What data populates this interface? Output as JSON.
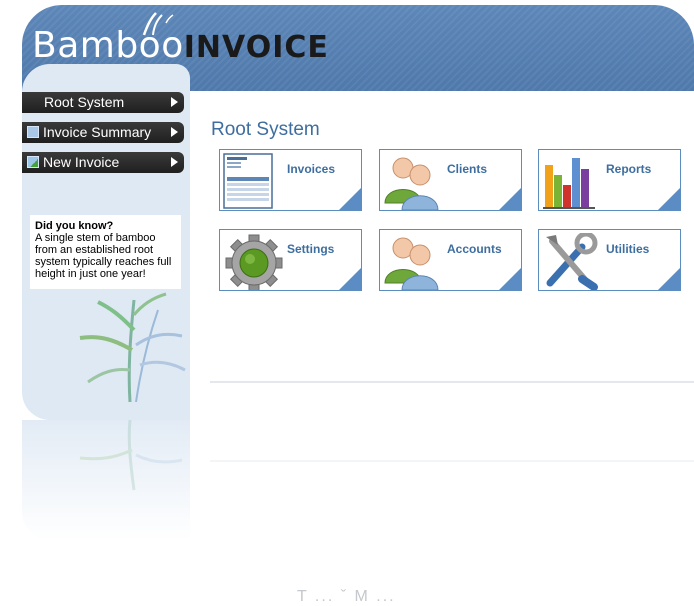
{
  "header": {
    "logo_part1": "Bamboo",
    "logo_part2": "INVOICE"
  },
  "sidebar": {
    "nav": [
      {
        "label": "Root System"
      },
      {
        "label": "Invoice Summary",
        "icon": "document-list-icon"
      },
      {
        "label": "New Invoice",
        "icon": "new-invoice-icon"
      }
    ],
    "tip": {
      "title": "Did you know?",
      "body": "A single stem of bamboo from an established root system typically reaches full height in just one year!"
    }
  },
  "main": {
    "title": "Root System",
    "tiles": [
      {
        "label": "Invoices",
        "icon": "invoice-document-icon"
      },
      {
        "label": "Clients",
        "icon": "users-icon"
      },
      {
        "label": "Reports",
        "icon": "bar-chart-icon"
      },
      {
        "label": "Settings",
        "icon": "gear-icon"
      },
      {
        "label": "Accounts",
        "icon": "users-icon"
      },
      {
        "label": "Utilities",
        "icon": "tools-icon"
      }
    ]
  },
  "footer": {
    "text": "T ... ˇ M ..."
  },
  "colors": {
    "header_blue": "#5d87b8",
    "title_blue": "#3e6e9f",
    "tile_border": "#5c8dbf",
    "sidebar_bg": "#dfe9f4"
  }
}
